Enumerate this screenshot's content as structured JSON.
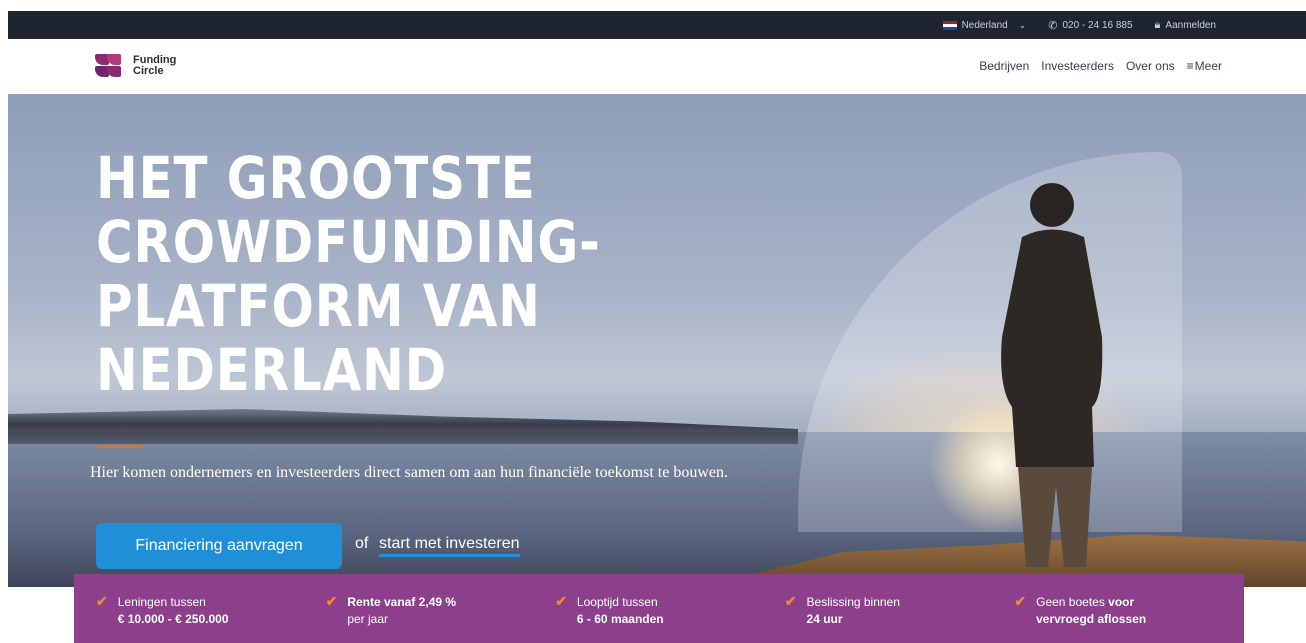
{
  "topbar": {
    "country": "Nederland",
    "phone": "020 - 24 16 885",
    "login": "Aanmelden"
  },
  "logo": {
    "line1": "Funding",
    "line2": "Circle"
  },
  "nav": {
    "items": [
      "Bedrijven",
      "Investeerders",
      "Over ons"
    ],
    "more": "Meer"
  },
  "hero": {
    "headline": "HET GROOTSTE\nCROWDFUNDING-\nPLATFORM VAN\nNEDERLAND",
    "subtitle": "Hier komen ondernemers en investeerders direct samen om aan hun financiële toekomst te bouwen.",
    "cta_button": "Financiering aanvragen",
    "cta_or": "of",
    "cta_link": "start met investeren"
  },
  "features": [
    {
      "line1": "Leningen tussen",
      "line2": "€ 10.000 - € 250.000"
    },
    {
      "line1": "Rente vanaf 2,49 %",
      "line2": "per jaar"
    },
    {
      "line1": "Looptijd tussen",
      "line2": "6 - 60 maanden"
    },
    {
      "line1": "Beslissing binnen",
      "line2": "24 uur"
    },
    {
      "line1a": "Geen boetes ",
      "line1b": "voor",
      "line2": "vervroegd aflossen"
    }
  ],
  "colors": {
    "topbar": "#1f2431",
    "brand_purple": "#8c3f8b",
    "cta_blue": "#1f8fd8",
    "accent_orange": "#e8701a"
  },
  "icons": [
    "flag-nl-icon",
    "chevron-down-icon",
    "phone-icon",
    "lock-icon",
    "menu-icon",
    "check-icon"
  ]
}
